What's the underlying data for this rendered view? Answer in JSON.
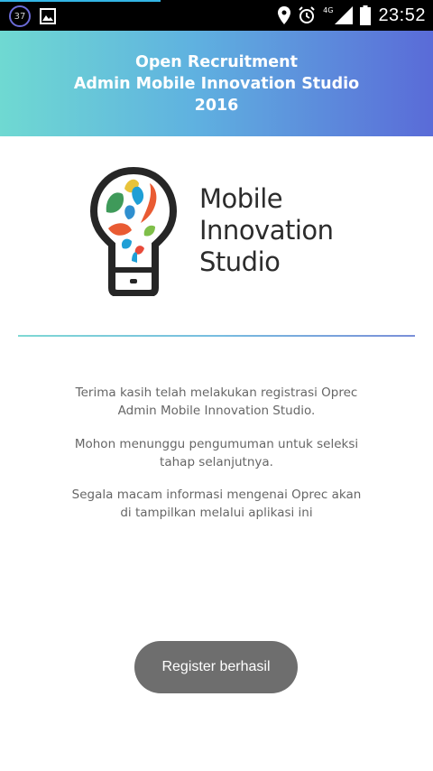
{
  "status_bar": {
    "notification_count": "37",
    "network": "4G",
    "time": "23:52",
    "icons": [
      "gallery-icon",
      "location-icon",
      "alarm-icon",
      "signal-icon",
      "battery-icon"
    ]
  },
  "header": {
    "line1": "Open Recruitment",
    "line2": "Admin Mobile Innovation Studio",
    "line3": "2016",
    "gradient_colors": [
      "#6fd9d2",
      "#5fb1e0",
      "#5a6bd8"
    ]
  },
  "logo": {
    "line1": "Mobile",
    "line2": "Innovation",
    "line3": "Studio"
  },
  "message": {
    "paragraph1_line1": "Terima kasih telah melakukan registrasi Oprec",
    "paragraph1_line2": "Admin Mobile Innovation Studio.",
    "paragraph2_line1": "Mohon menunggu pengumuman untuk seleksi",
    "paragraph2_line2": "tahap selanjutnya.",
    "paragraph3_line1": "Segala macam informasi mengenai Oprec akan",
    "paragraph3_line2": "di tampilkan melalui aplikasi ini"
  },
  "toast": {
    "text": "Register berhasil"
  }
}
